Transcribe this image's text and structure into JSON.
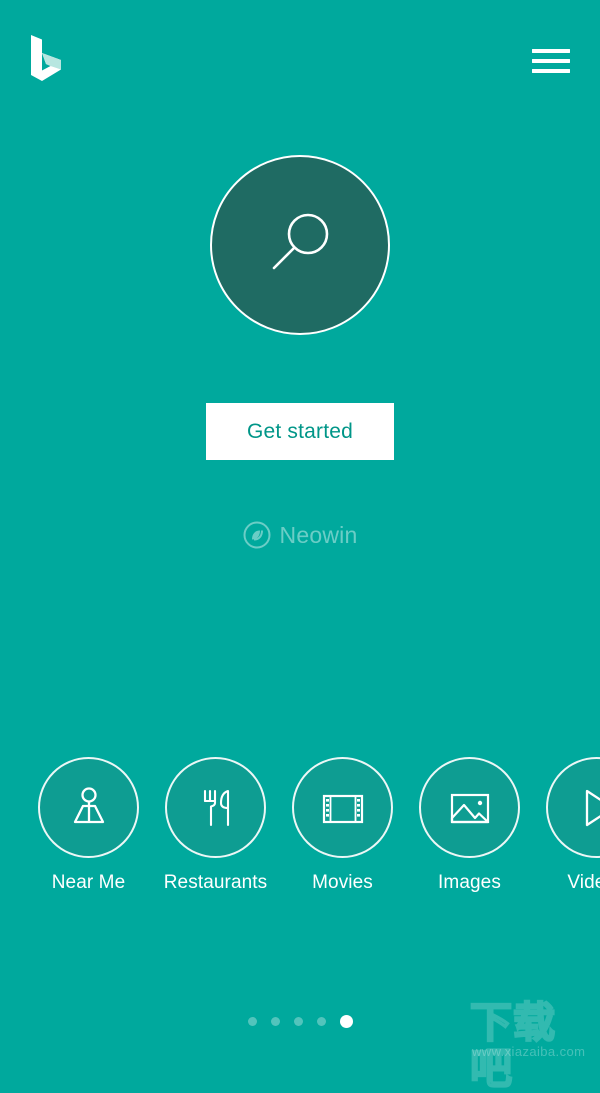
{
  "app": {
    "name": "Bing",
    "background_color": "#00a99d",
    "accent_color": "#009688",
    "orb_color": "#1f6b63",
    "circle_fill_color": "#0e9d92"
  },
  "topbar": {
    "logo_name": "bing-logo",
    "menu_label": "Menu",
    "menu_icon": "hamburger-icon"
  },
  "hero": {
    "search_icon": "search-icon",
    "search_aria_label": "Search"
  },
  "cta": {
    "label": "Get started"
  },
  "watermark": {
    "brand": "Neowin",
    "brand_icon": "neowin-logo-icon",
    "site_cn": "下载吧",
    "site_url": "www.xiazaiba.com"
  },
  "categories": [
    {
      "label": "Near Me",
      "icon": "person-on-map-icon"
    },
    {
      "label": "Restaurants",
      "icon": "fork-knife-icon"
    },
    {
      "label": "Movies",
      "icon": "film-strip-icon"
    },
    {
      "label": "Images",
      "icon": "picture-icon"
    },
    {
      "label": "Videos",
      "icon": "play-triangle-icon"
    }
  ],
  "pager": {
    "total": 5,
    "active_index": 4,
    "dots": [
      "1",
      "2",
      "3",
      "4",
      "5"
    ]
  }
}
